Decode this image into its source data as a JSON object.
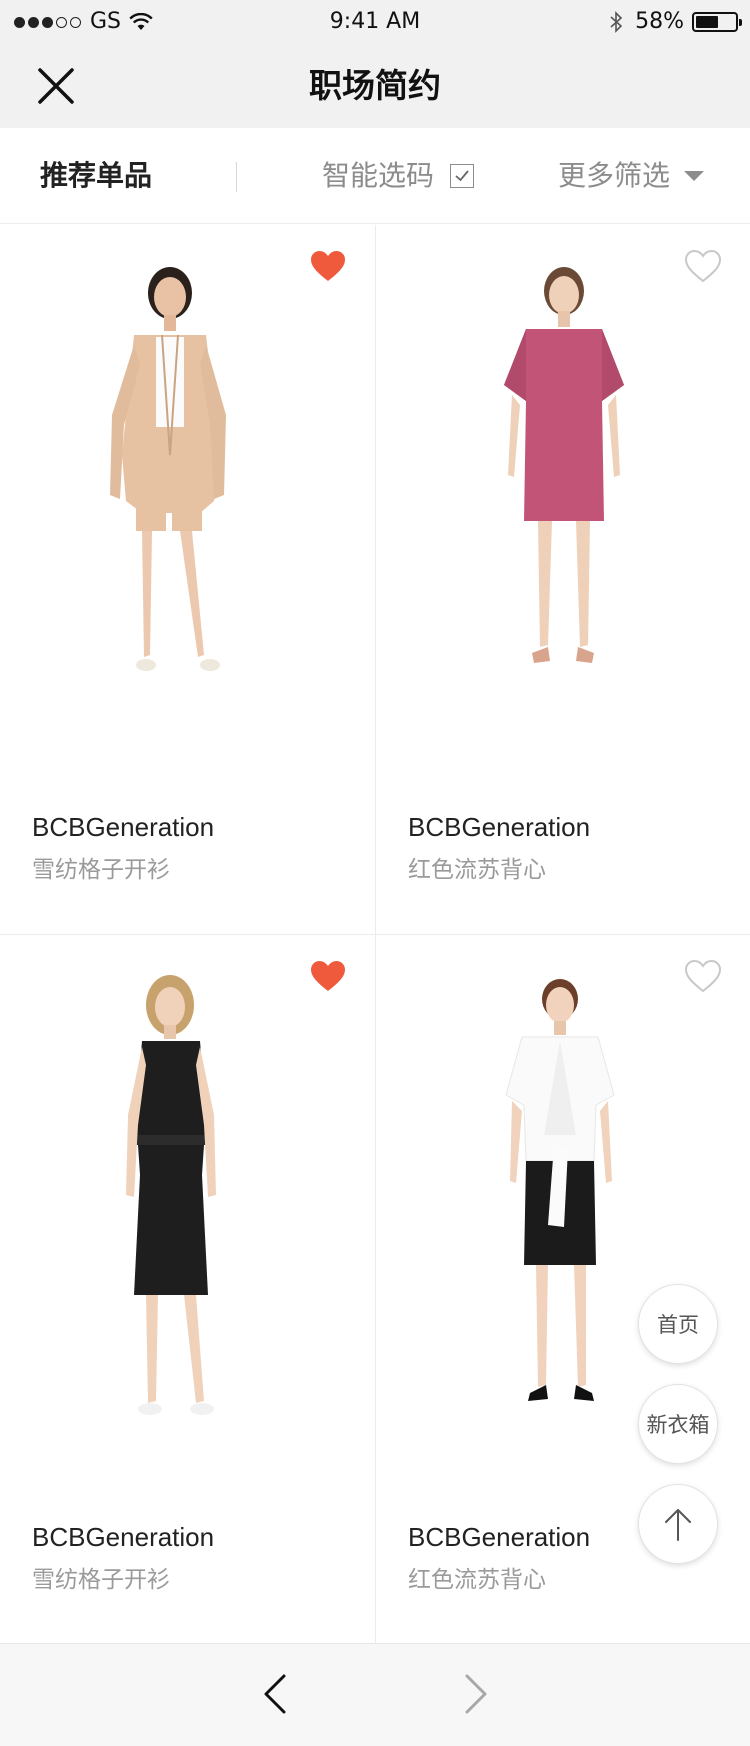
{
  "status_bar": {
    "carrier": "GS",
    "time": "9:41 AM",
    "battery": "58%",
    "battery_level": 0.58,
    "signal_dots_filled": 3,
    "signal_dots_total": 5
  },
  "nav": {
    "title": "职场简约",
    "close_icon": "close-icon"
  },
  "filters": {
    "recommended": "推荐单品",
    "smart_pick": "智能选码",
    "smart_pick_checked": true,
    "more_filters": "更多筛选"
  },
  "products": [
    {
      "brand": "BCBGeneration",
      "desc": "雪纺格子开衫",
      "favorited": true
    },
    {
      "brand": "BCBGeneration",
      "desc": "红色流苏背心",
      "favorited": false
    },
    {
      "brand": "BCBGeneration",
      "desc": "雪纺格子开衫",
      "favorited": true
    },
    {
      "brand": "BCBGeneration",
      "desc": "红色流苏背心",
      "favorited": false
    }
  ],
  "float_buttons": {
    "home": "首页",
    "wardrobe": "新衣箱",
    "top_icon": "arrow-up-icon"
  },
  "colors": {
    "favorite": "#f05a3c",
    "accent_gray": "#8c8c8c"
  }
}
